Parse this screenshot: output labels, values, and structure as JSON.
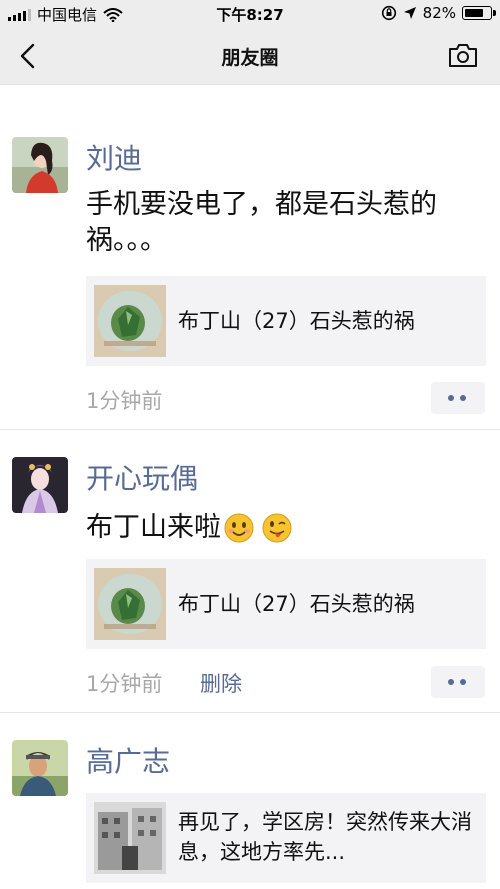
{
  "status_bar": {
    "carrier": "中国电信",
    "time": "下午8:27",
    "battery": "82%",
    "battery_level": 0.82,
    "icons": [
      "signal-icon",
      "wifi-icon",
      "rotation-lock-icon",
      "location-icon",
      "battery-icon"
    ]
  },
  "nav": {
    "title": "朋友圈",
    "back_icon": "back-icon",
    "camera_icon": "camera-icon"
  },
  "posts": [
    {
      "name": "刘迪",
      "text": "手机要没电了，都是石头惹的祸。。。",
      "link_title": "布丁山（27）石头惹的祸",
      "time": "1分钟前"
    },
    {
      "name": "开心玩偶",
      "text": "布丁山来啦",
      "emojis": [
        "smiling-face-emoji",
        "winking-face-with-tongue-emoji"
      ],
      "link_title": "布丁山（27）石头惹的祸",
      "time": "1分钟前",
      "delete_label": "删除"
    },
    {
      "name": "高广志",
      "link_title": "再见了，学区房！突然传来大消息，这地方率先..."
    }
  ],
  "colors": {
    "link_blue": "#576b95",
    "card_bg": "#f3f3f5",
    "nav_bg": "#ededed",
    "time_gray": "#a8a8a8"
  }
}
